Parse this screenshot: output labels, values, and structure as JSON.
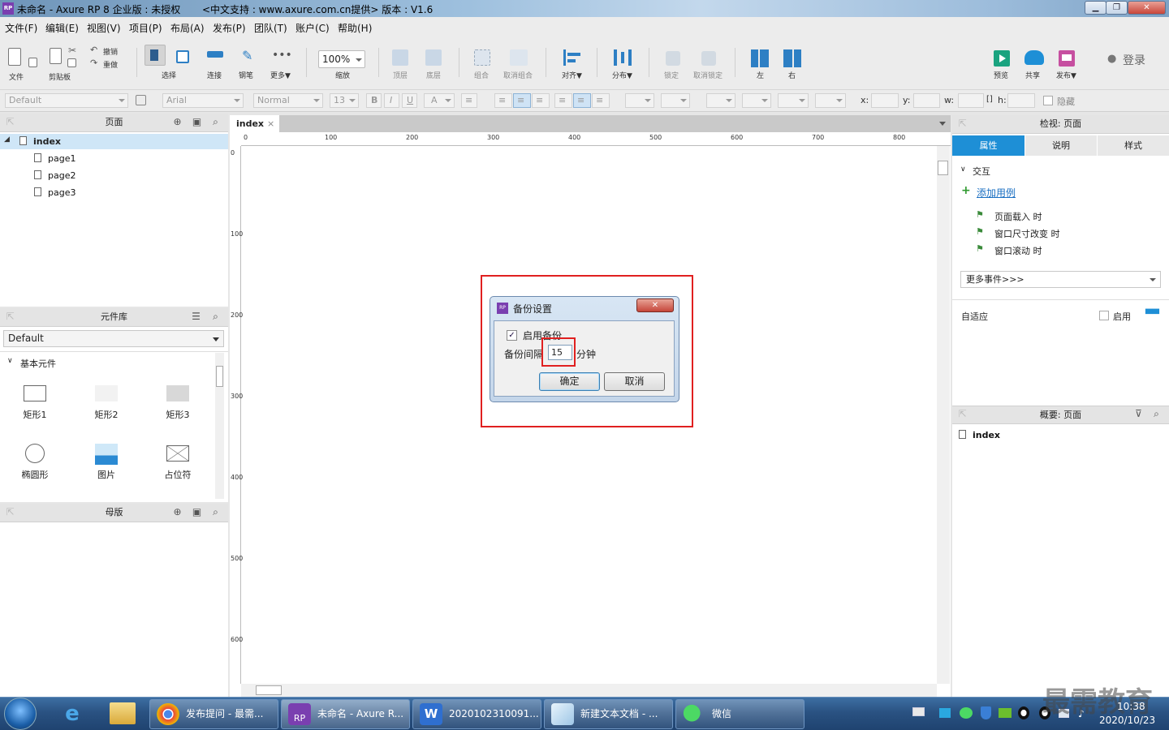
{
  "window": {
    "title": "未命名 - Axure RP 8 企业版 : 未授权       <中文支持 : www.axure.com.cn提供> 版本 : V1.6",
    "app_icon": "RP",
    "controls": [
      "minimize",
      "maximize",
      "close"
    ]
  },
  "menu": [
    "文件(F)",
    "编辑(E)",
    "视图(V)",
    "项目(P)",
    "布局(A)",
    "发布(P)",
    "团队(T)",
    "账户(C)",
    "帮助(H)"
  ],
  "toolbar": {
    "file": "文件",
    "clipboard": "剪贴板",
    "undo": "撤销",
    "redo": "重做",
    "select": "选择",
    "connect": "连接",
    "pen": "钢笔",
    "more": "更多▼",
    "zoom_value": "100%",
    "zoom": "缩放",
    "top": "顶层",
    "bottom": "底层",
    "group": "组合",
    "ungroup": "取消组合",
    "align": "对齐▼",
    "distribute": "分布▼",
    "lock": "锁定",
    "unlock": "取消锁定",
    "left": "左",
    "right": "右",
    "preview": "预览",
    "share": "共享",
    "publish": "发布▼",
    "login": "登录"
  },
  "formatbar": {
    "style": "Default",
    "font": "Arial",
    "weight": "Normal",
    "size": "13",
    "x_label": "x:",
    "y_label": "y:",
    "w_label": "w:",
    "h_label": "h:",
    "hidden": "隐藏"
  },
  "pages_panel": {
    "title": "页面",
    "root": "index",
    "children": [
      "page1",
      "page2",
      "page3"
    ]
  },
  "library_panel": {
    "title": "元件库",
    "library": "Default",
    "section": "基本元件",
    "widgets": [
      "矩形1",
      "矩形2",
      "矩形3",
      "椭圆形",
      "图片",
      "占位符"
    ]
  },
  "masters_panel": {
    "title": "母版"
  },
  "canvas": {
    "tab": "index",
    "ruler_h": [
      "0",
      "100",
      "200",
      "300",
      "400",
      "500",
      "600",
      "700",
      "800"
    ],
    "ruler_v": [
      "0",
      "100",
      "200",
      "300",
      "400",
      "500",
      "600"
    ]
  },
  "dialog": {
    "title": "备份设置",
    "enable_label": "启用备份",
    "enable_checked": true,
    "interval_label": "备份间隔",
    "interval_value": "15",
    "unit": "分钟",
    "ok": "确定",
    "cancel": "取消"
  },
  "inspector": {
    "title": "检视: 页面",
    "tabs": [
      "属性",
      "说明",
      "样式"
    ],
    "section_interaction": "交互",
    "add_case": "添加用例",
    "events": [
      "页面载入 时",
      "窗口尺寸改变 时",
      "窗口滚动 时"
    ],
    "more_events": "更多事件>>>",
    "adaptive_label": "自适应",
    "adaptive_enable": "启用"
  },
  "outline_panel": {
    "title": "概要: 页面",
    "item": "index"
  },
  "taskbar": {
    "items": [
      "发布提问 - 最需...",
      "未命名 - Axure R...",
      "2020102310091...",
      "新建文本文档 - ...",
      "微信"
    ],
    "time": "10:38",
    "date": "2020/10/23",
    "watermark": "最需教育"
  },
  "colors": {
    "accent_blue": "#1e8fd6",
    "highlight_red": "#e02020",
    "selected_row": "#cfe6f7",
    "link": "#1a6fc2"
  }
}
